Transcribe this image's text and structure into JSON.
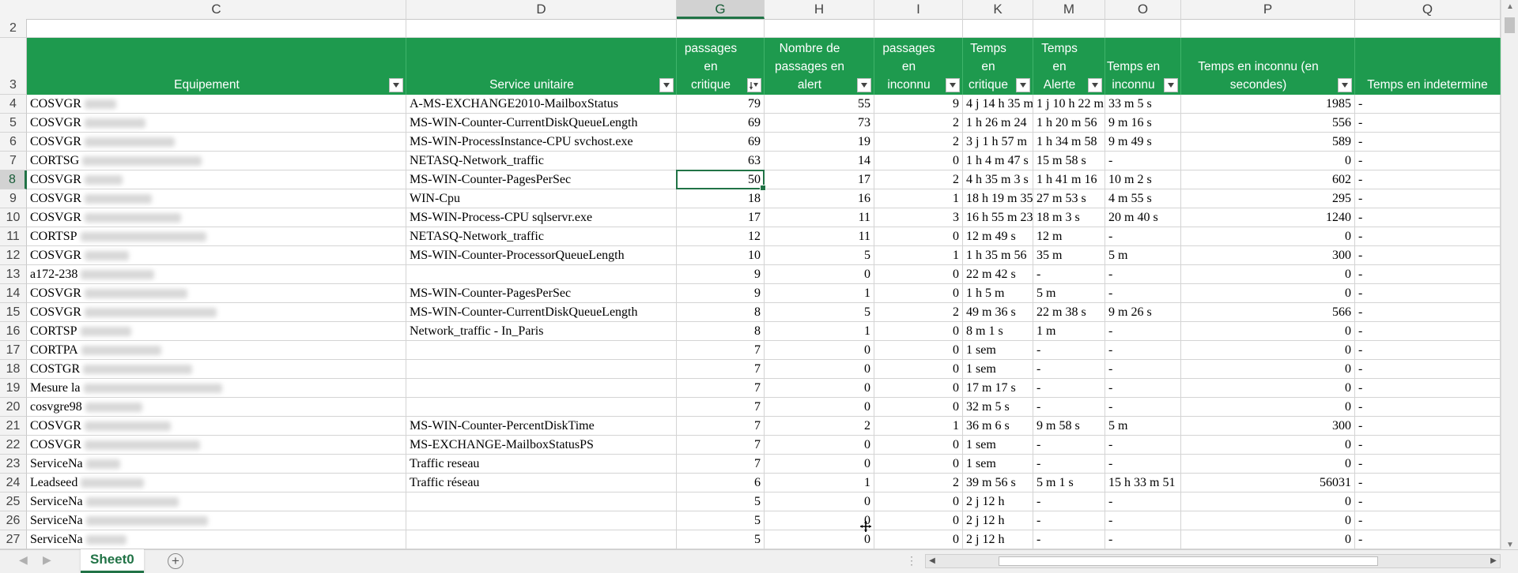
{
  "columns": [
    {
      "letter": "",
      "key": "B"
    },
    {
      "letter": "C"
    },
    {
      "letter": "D"
    },
    {
      "letter": "G"
    },
    {
      "letter": "H"
    },
    {
      "letter": "I"
    },
    {
      "letter": "K"
    },
    {
      "letter": "M"
    },
    {
      "letter": "O"
    },
    {
      "letter": "P"
    },
    {
      "letter": "Q"
    }
  ],
  "selected_column": "G",
  "selected_row": "8",
  "headers": [
    "",
    "Equipement",
    "Service unitaire",
    "Nombre de\npassages en\ncritique",
    "Nombre de\npassages en alert",
    "Nombre de\npassages en\ninconnu",
    "Temps en\ncritique",
    "Temps en\nAlerte",
    "Temps en\ninconnu",
    "Temps en inconnu (en\nsecondes)",
    "Temps en indetermine"
  ],
  "row_numbers": [
    "2",
    "3",
    "4",
    "5",
    "6",
    "7",
    "8",
    "9",
    "10",
    "11",
    "12",
    "13",
    "14",
    "15",
    "16",
    "17",
    "18",
    "19",
    "20",
    "21",
    "22",
    "23",
    "24",
    "25",
    "26",
    "27"
  ],
  "rows": [
    {
      "n": "4",
      "c": "COSVGR",
      "d": "A-MS-EXCHANGE2010-MailboxStatus",
      "g": "79",
      "h": "55",
      "i": "9",
      "k": "4 j 14 h 35 m",
      "m": "1 j 10 h 22 m",
      "o": "33 m 5 s",
      "p": "1985",
      "q": "-"
    },
    {
      "n": "5",
      "c": "COSVGR",
      "d": "MS-WIN-Counter-CurrentDiskQueueLength",
      "g": "69",
      "h": "73",
      "i": "2",
      "k": "1 h 26 m 24",
      "m": "1 h 20 m 56",
      "o": "9 m 16 s",
      "p": "556",
      "q": "-"
    },
    {
      "n": "6",
      "c": "COSVGR",
      "d": "MS-WIN-ProcessInstance-CPU svchost.exe",
      "g": "69",
      "h": "19",
      "i": "2",
      "k": "3 j 1 h 57 m",
      "m": "1 h 34 m 58",
      "o": "9 m 49 s",
      "p": "589",
      "q": "-"
    },
    {
      "n": "7",
      "c": "CORTSG",
      "d": "NETASQ-Network_traffic",
      "g": "63",
      "h": "14",
      "i": "0",
      "k": "1 h 4 m 47 s",
      "m": "15 m 58 s",
      "o": "-",
      "p": "0",
      "q": "-"
    },
    {
      "n": "8",
      "c": "COSVGR",
      "d": "MS-WIN-Counter-PagesPerSec",
      "g": "50",
      "h": "17",
      "i": "2",
      "k": "4 h 35 m 3 s",
      "m": "1 h 41 m 16",
      "o": "10 m 2 s",
      "p": "602",
      "q": "-"
    },
    {
      "n": "9",
      "c": "COSVGR",
      "d": "WIN-Cpu",
      "g": "18",
      "h": "16",
      "i": "1",
      "k": "18 h 19 m 35",
      "m": "27 m 53 s",
      "o": "4 m 55 s",
      "p": "295",
      "q": "-"
    },
    {
      "n": "10",
      "c": "COSVGR",
      "d": "MS-WIN-Process-CPU sqlservr.exe",
      "g": "17",
      "h": "11",
      "i": "3",
      "k": "16 h 55 m 23",
      "m": "18 m 3 s",
      "o": "20 m 40 s",
      "p": "1240",
      "q": "-"
    },
    {
      "n": "11",
      "c": "CORTSP",
      "d": "NETASQ-Network_traffic",
      "g": "12",
      "h": "11",
      "i": "0",
      "k": "12 m 49 s",
      "m": "12 m",
      "o": "-",
      "p": "0",
      "q": "-"
    },
    {
      "n": "12",
      "c": "COSVGR",
      "d": "MS-WIN-Counter-ProcessorQueueLength",
      "g": "10",
      "h": "5",
      "i": "1",
      "k": "1 h 35 m 56",
      "m": "35 m",
      "o": "5 m",
      "p": "300",
      "q": "-"
    },
    {
      "n": "13",
      "c": "a172-238",
      "d": "",
      "g": "9",
      "h": "0",
      "i": "0",
      "k": "22 m 42 s",
      "m": "-",
      "o": "-",
      "p": "0",
      "q": "-"
    },
    {
      "n": "14",
      "c": "COSVGR",
      "d": "MS-WIN-Counter-PagesPerSec",
      "g": "9",
      "h": "1",
      "i": "0",
      "k": "1 h 5 m",
      "m": "5 m",
      "o": "-",
      "p": "0",
      "q": "-"
    },
    {
      "n": "15",
      "c": "COSVGR",
      "d": "MS-WIN-Counter-CurrentDiskQueueLength",
      "g": "8",
      "h": "5",
      "i": "2",
      "k": "49 m 36 s",
      "m": "22 m 38 s",
      "o": "9 m 26 s",
      "p": "566",
      "q": "-"
    },
    {
      "n": "16",
      "c": "CORTSP",
      "d": "Network_traffic - In_Paris",
      "g": "8",
      "h": "1",
      "i": "0",
      "k": "8 m 1 s",
      "m": "1 m",
      "o": "-",
      "p": "0",
      "q": "-"
    },
    {
      "n": "17",
      "c": "CORTPA",
      "d": "",
      "g": "7",
      "h": "0",
      "i": "0",
      "k": "1 sem",
      "m": "-",
      "o": "-",
      "p": "0",
      "q": "-"
    },
    {
      "n": "18",
      "c": "COSTGR",
      "d": "",
      "g": "7",
      "h": "0",
      "i": "0",
      "k": "1 sem",
      "m": "-",
      "o": "-",
      "p": "0",
      "q": "-"
    },
    {
      "n": "19",
      "c": "Mesure la",
      "d": "",
      "g": "7",
      "h": "0",
      "i": "0",
      "k": "17 m 17 s",
      "m": "-",
      "o": "-",
      "p": "0",
      "q": "-"
    },
    {
      "n": "20",
      "c": "cosvgre98",
      "d": "",
      "g": "7",
      "h": "0",
      "i": "0",
      "k": "32 m 5 s",
      "m": "-",
      "o": "-",
      "p": "0",
      "q": "-"
    },
    {
      "n": "21",
      "c": "COSVGR",
      "d": "MS-WIN-Counter-PercentDiskTime",
      "g": "7",
      "h": "2",
      "i": "1",
      "k": "36 m 6 s",
      "m": "9 m 58 s",
      "o": "5 m",
      "p": "300",
      "q": "-"
    },
    {
      "n": "22",
      "c": "COSVGR",
      "d": "MS-EXCHANGE-MailboxStatusPS",
      "g": "7",
      "h": "0",
      "i": "0",
      "k": "1 sem",
      "m": "-",
      "o": "-",
      "p": "0",
      "q": "-"
    },
    {
      "n": "23",
      "c": "ServiceNa",
      "d": "Traffic reseau",
      "g": "7",
      "h": "0",
      "i": "0",
      "k": "1 sem",
      "m": "-",
      "o": "-",
      "p": "0",
      "q": "-"
    },
    {
      "n": "24",
      "c": "Leadseed",
      "d": "Traffic réseau",
      "g": "6",
      "h": "1",
      "i": "2",
      "k": "39 m 56 s",
      "m": "5 m 1 s",
      "o": "15 h 33 m 51",
      "p": "56031",
      "q": "-"
    },
    {
      "n": "25",
      "c": "ServiceNa",
      "d": "",
      "g": "5",
      "h": "0",
      "i": "0",
      "k": "2 j 12 h",
      "m": "-",
      "o": "-",
      "p": "0",
      "q": "-"
    },
    {
      "n": "26",
      "c": "ServiceNa",
      "d": "",
      "g": "5",
      "h": "0",
      "i": "0",
      "k": "2 j 12 h",
      "m": "-",
      "o": "-",
      "p": "0",
      "q": "-"
    },
    {
      "n": "27",
      "c": "ServiceNa",
      "d": "",
      "g": "5",
      "h": "0",
      "i": "0",
      "k": "2 j 12 h",
      "m": "-",
      "o": "-",
      "p": "0",
      "q": "-"
    }
  ],
  "sheet_tab": "Sheet0",
  "add_sheet_symbol": "+",
  "accent_color": "#217346",
  "header_fill": "#1e9a4e"
}
